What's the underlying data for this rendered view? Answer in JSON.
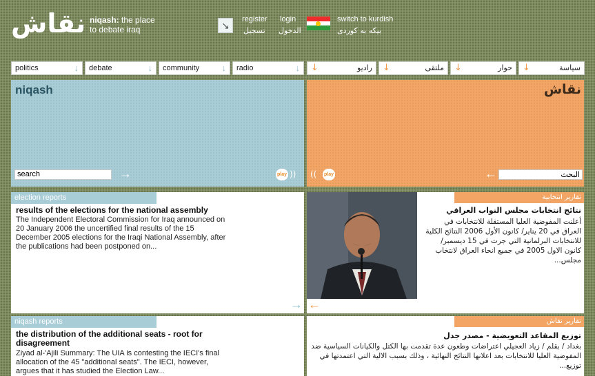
{
  "header": {
    "logo_ar": "نقاش",
    "tagline_brand": "niqash:",
    "tagline_rest": " the place",
    "tagline_line2": "to debate iraq",
    "register": "register",
    "login": "login",
    "register_ar": "تسجيل",
    "login_ar": "الدخول",
    "switch_lang": "switch to kurdish",
    "switch_lang_ku": "بيكه به كوردى",
    "arrow_glyph": "↘"
  },
  "nav": {
    "en": [
      "politics",
      "debate",
      "community",
      "radio"
    ],
    "ar": [
      "راديو",
      "ملتقى",
      "حوار",
      "سياسة"
    ],
    "arrow_glyph": "↓"
  },
  "hero": {
    "title_en": "niqash",
    "title_ar": "نقاش",
    "search_placeholder_en": "search",
    "search_placeholder_ar": "البحث",
    "go_en": "→",
    "go_ar": "←",
    "play_label": "play",
    "sound_en": "))",
    "sound_ar": "(("
  },
  "articles": {
    "election": {
      "section_en": "election reports",
      "title_en": "results of the elections for the national assembly",
      "body_en": "The Independent Electoral Commission for Iraq announced on 20 January 2006 the uncertified final results of the 15 December 2005 elections for the Iraqi National Assembly, after the publications had been postponed on...",
      "section_ar": "تقارير انتخابية",
      "title_ar": "نتائج انتخابات مجلس النواب العراقي",
      "body_ar": "أعلنت المفوضية العليا المستقلة للانتخابات في العراق في 20 يناير/ كانون الأول 2006 النتائج الكلية للانتخابات البرلمانية التي جرت في 15 ديسمبر/ كانون الاول 2005 في جميع انحاء العراق لانتخاب مجلس...",
      "more_en": "→",
      "more_ar": "←"
    },
    "niqash": {
      "section_en": "niqash reports",
      "title_en": "the distribution of the additional seats - root for disagreement",
      "body_en": "Ziyad al-'Ajili Summary: The UIA is contesting the IECI's final allocation of the 45 \"additional seats\". The IECI, however, argues that it has studied the Election Law...",
      "section_ar": "تقارير نقاش",
      "title_ar": "توزيع المقاعد التعويضية - مصدر جدل",
      "body_ar": "بغداد / بقلم / زياد العجيلي اعتراضات وطعون عدة تقدمت بها الكتل والكيانات السياسية ضد المفوضية العليا للانتخابات بعد اعلانها النتائج النهائية ، وذلك بسبب الالية التي اعتمدتها في توزيع..."
    }
  },
  "colors": {
    "background": "#7d8a5e",
    "accent_blue": "#a9cdd7",
    "accent_orange": "#f2a564"
  }
}
